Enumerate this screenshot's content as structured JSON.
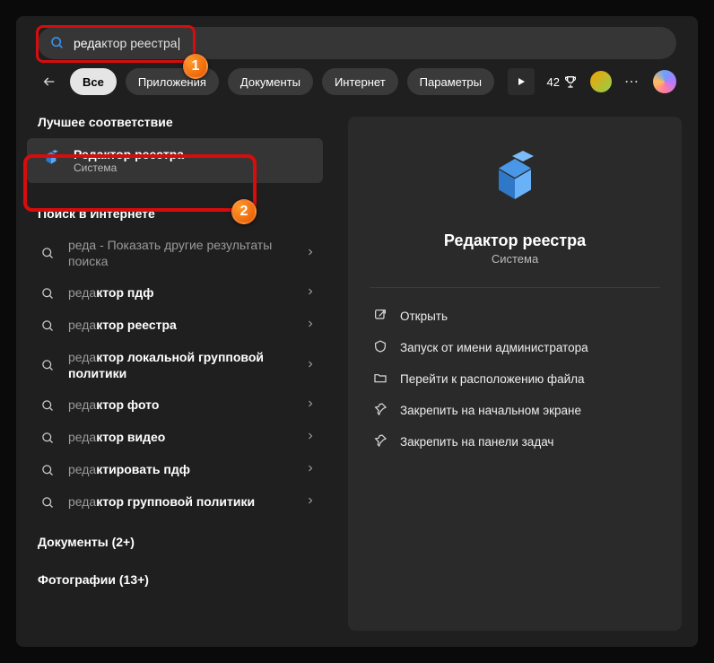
{
  "search": {
    "query_typed": "реда",
    "query_rest": "ктор реестра"
  },
  "tabs": {
    "items": [
      "Все",
      "Приложения",
      "Документы",
      "Интернет",
      "Параметры"
    ],
    "active_index": 0,
    "points": "42"
  },
  "left": {
    "best_match_header": "Лучшее соответствие",
    "best": {
      "title": "Редактор реестра",
      "subtitle": "Система"
    },
    "web_header": "Поиск в Интернете",
    "web_items": [
      {
        "pre": "реда",
        "bold": "",
        "suffix": " - Показать другие результаты поиска"
      },
      {
        "pre": "реда",
        "bold": "ктор пдф",
        "suffix": ""
      },
      {
        "pre": "реда",
        "bold": "ктор реестра",
        "suffix": ""
      },
      {
        "pre": "реда",
        "bold": "ктор локальной групповой политики",
        "suffix": ""
      },
      {
        "pre": "реда",
        "bold": "ктор фото",
        "suffix": ""
      },
      {
        "pre": "реда",
        "bold": "ктор видео",
        "suffix": ""
      },
      {
        "pre": "реда",
        "bold": "ктировать пдф",
        "suffix": ""
      },
      {
        "pre": "реда",
        "bold": "ктор групповой политики",
        "suffix": ""
      }
    ],
    "docs_header": "Документы (2+)",
    "photos_header": "Фотографии (13+)"
  },
  "preview": {
    "title": "Редактор реестра",
    "subtitle": "Система",
    "actions": [
      {
        "icon": "open",
        "label": "Открыть"
      },
      {
        "icon": "admin",
        "label": "Запуск от имени администратора"
      },
      {
        "icon": "loc",
        "label": "Перейти к расположению файла"
      },
      {
        "icon": "pin",
        "label": "Закрепить на начальном экране"
      },
      {
        "icon": "pin",
        "label": "Закрепить на панели задач"
      }
    ]
  },
  "annotations": {
    "one": "1",
    "two": "2"
  }
}
